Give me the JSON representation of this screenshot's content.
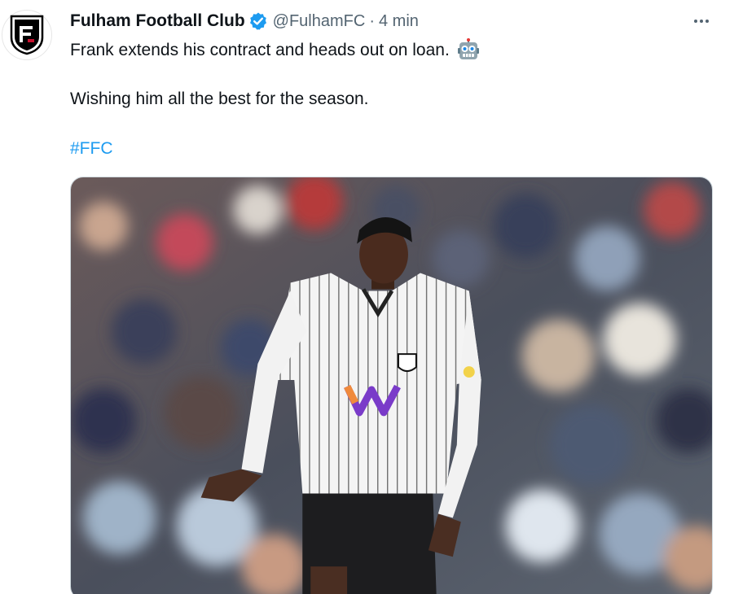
{
  "author": {
    "display_name": "Fulham Football Club",
    "handle": "@FulhamFC",
    "separator": "·",
    "time": "4 min",
    "verified_icon": "verified-badge-icon",
    "avatar_icon": "fulham-crest-icon"
  },
  "tweet": {
    "line1": "Frank extends his contract and heads out on loan.",
    "line1_emoji": "robot-emoji-icon",
    "line2": "Wishing him all the best for the season.",
    "hashtag": "#FFC"
  },
  "menu": {
    "icon": "more-options-icon"
  },
  "colors": {
    "link": "#1d9bf0",
    "verified": "#1d9bf0",
    "secondary_text": "#536471"
  }
}
